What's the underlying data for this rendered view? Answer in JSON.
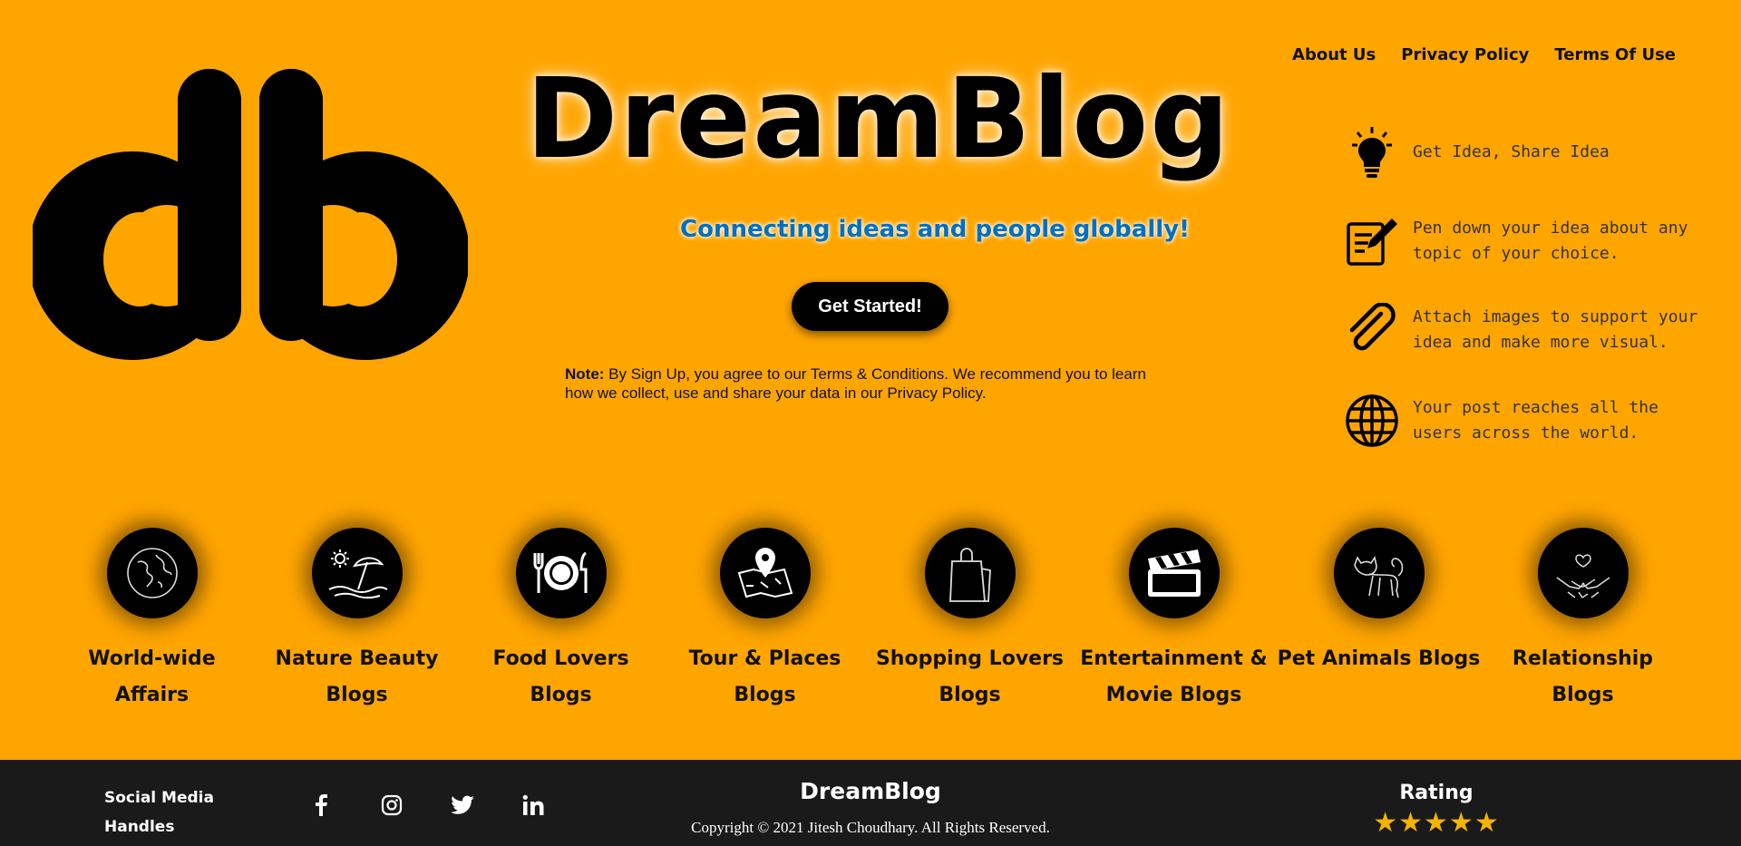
{
  "logo": {
    "text": "db"
  },
  "nav": {
    "items": [
      "About Us",
      "Privacy Policy",
      "Terms Of Use"
    ]
  },
  "hero": {
    "title": "DreamBlog",
    "tagline": "Connecting ideas and people globally!",
    "cta_label": "Get Started!",
    "note_label": "Note:",
    "note_text": " By Sign Up, you agree to our Terms & Conditions. We recommend you to learn how we collect, use and share your data in our Privacy Policy."
  },
  "features": [
    {
      "icon": "lightbulb-icon",
      "text": "Get Idea, Share Idea"
    },
    {
      "icon": "pen-notepad-icon",
      "text": "Pen down your idea about any topic of your choice."
    },
    {
      "icon": "paperclip-icon",
      "text": "Attach images to support your idea and make more visual."
    },
    {
      "icon": "globe-icon",
      "text": "Your post reaches all the users across the world."
    }
  ],
  "categories": [
    {
      "icon": "earth-icon",
      "label": "World-wide Affairs"
    },
    {
      "icon": "beach-umbrella-icon",
      "label": "Nature Beauty Blogs"
    },
    {
      "icon": "plate-cutlery-icon",
      "label": "Food Lovers Blogs"
    },
    {
      "icon": "map-pin-icon",
      "label": "Tour & Places Blogs"
    },
    {
      "icon": "shopping-bag-icon",
      "label": "Shopping Lovers Blogs"
    },
    {
      "icon": "clapperboard-icon",
      "label": "Entertainment & Movie Blogs"
    },
    {
      "icon": "cat-icon",
      "label": "Pet Animals Blogs"
    },
    {
      "icon": "holding-hands-icon",
      "label": "Relationship Blogs"
    }
  ],
  "footer": {
    "handles_label": "Social Media Handles",
    "socials": [
      "facebook-icon",
      "instagram-icon",
      "twitter-icon",
      "linkedin-icon"
    ],
    "brand": "DreamBlog",
    "copyright": "Copyright © 2021 Jitesh Choudhary. All Rights Reserved.",
    "rating_label": "Rating",
    "rating_stars": 5,
    "stars_text": "★★★★★"
  },
  "colors": {
    "background": "#FFA500",
    "tagline": "#0070C0",
    "footer_bg": "#1A1A1A",
    "star": "#F5B301"
  }
}
